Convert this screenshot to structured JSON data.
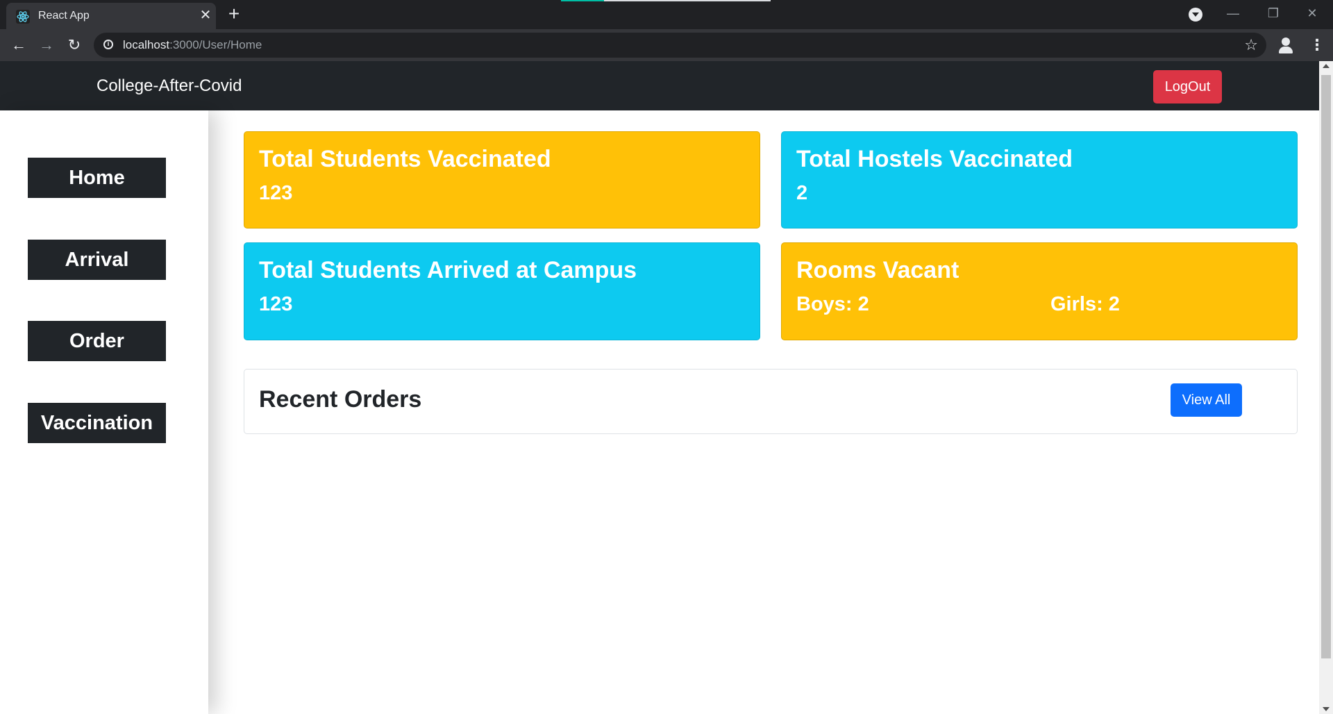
{
  "browser": {
    "tab_title": "React App",
    "tab_favicon": "react-icon",
    "url_host": "localhost",
    "url_rest": ":3000/User/Home",
    "icons": [
      "back-icon",
      "forward-icon",
      "reload-icon",
      "info-icon",
      "star-icon",
      "profile-icon",
      "menu-icon",
      "tab-search-icon",
      "minimize-icon",
      "restore-icon",
      "close-icon"
    ]
  },
  "navbar": {
    "brand": "College-After-Covid",
    "logout_label": "LogOut",
    "logout_color": "#dc3545"
  },
  "sidebar": {
    "items": [
      {
        "label": "Home"
      },
      {
        "label": "Arrival"
      },
      {
        "label": "Order"
      },
      {
        "label": "Vaccination"
      }
    ]
  },
  "cards": {
    "students_vaccinated": {
      "title": "Total Students Vaccinated",
      "value": "123",
      "color": "#ffc107"
    },
    "hostels_vaccinated": {
      "title": "Total Hostels Vaccinated",
      "value": "2",
      "color": "#0dcaf0"
    },
    "students_arrived": {
      "title": "Total Students Arrived at Campus",
      "value": "123",
      "color": "#0dcaf0"
    },
    "rooms_vacant": {
      "title": "Rooms Vacant",
      "boys": "Boys: 2",
      "girls": "Girls: 2",
      "color": "#ffc107"
    }
  },
  "recent_orders": {
    "title": "Recent Orders",
    "view_all_label": "View All",
    "view_all_color": "#0d6efd"
  }
}
